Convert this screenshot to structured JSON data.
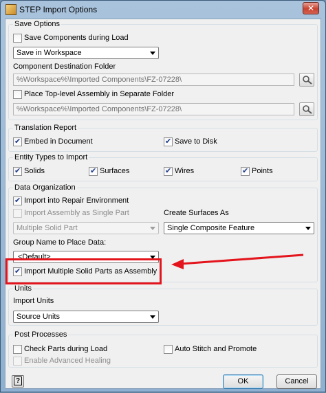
{
  "window": {
    "title": "STEP Import Options",
    "close_glyph": "✕"
  },
  "save_options": {
    "title": "Save Options",
    "save_components_label": "Save Components during Load",
    "save_components_checked": false,
    "save_mode": "Save in Workspace",
    "dest_folder_label": "Component Destination Folder",
    "dest_folder_value": "%Workspace%\\Imported Components\\FZ-07228\\",
    "top_level_label": "Place Top-level Assembly in Separate Folder",
    "top_level_checked": false,
    "top_level_folder_value": "%Workspace%\\Imported Components\\FZ-07228\\"
  },
  "translation_report": {
    "title": "Translation Report",
    "embed_label": "Embed in Document",
    "embed_checked": true,
    "save_disk_label": "Save to Disk",
    "save_disk_checked": true
  },
  "entity_types": {
    "title": "Entity Types to Import",
    "solids_label": "Solids",
    "surfaces_label": "Surfaces",
    "wires_label": "Wires",
    "points_label": "Points"
  },
  "data_org": {
    "title": "Data Organization",
    "repair_label": "Import into Repair Environment",
    "repair_checked": true,
    "single_part_label": "Import Assembly as Single Part",
    "create_surfaces_label": "Create Surfaces As",
    "multiple_solid_value": "Multiple Solid Part",
    "surfaces_as_value": "Single Composite Feature",
    "group_name_label": "Group Name to Place Data:",
    "group_name_value": "<Default>",
    "multi_assembly_label": "Import Multiple Solid Parts as Assembly",
    "multi_assembly_checked": true
  },
  "units": {
    "title": "Units",
    "import_units_label": "Import Units",
    "import_units_value": "Source Units"
  },
  "post": {
    "title": "Post Processes",
    "check_parts_label": "Check Parts during Load",
    "auto_stitch_label": "Auto Stitch and Promote",
    "healing_label": "Enable Advanced Healing"
  },
  "buttons": {
    "help": "?",
    "ok": "OK",
    "cancel": "Cancel"
  },
  "colors": {
    "annotation": "#e3141b"
  },
  "icons": [
    "app-icon",
    "close-icon",
    "browse-icon",
    "help-icon",
    "checkbox-check-icon",
    "dropdown-arrow-icon",
    "annotation-arrow-icon"
  ]
}
